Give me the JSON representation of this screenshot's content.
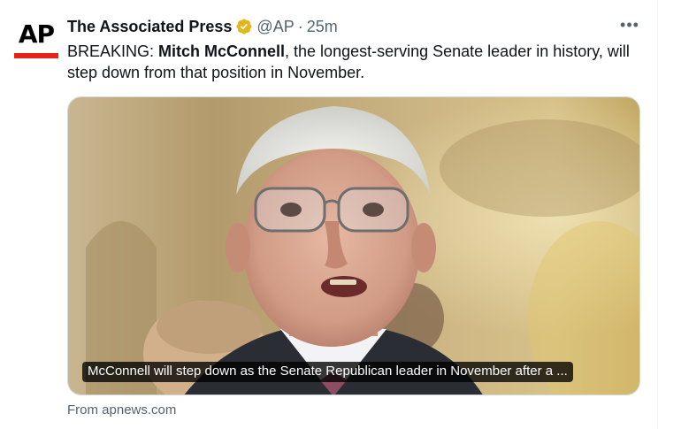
{
  "account": {
    "display_name": "The Associated Press",
    "handle": "@AP",
    "separator": "·",
    "timestamp": "25m",
    "avatar_text": "AP",
    "verified_icon": "verified-badge-icon",
    "verified_color": "#e2b719"
  },
  "more_icon": "•••",
  "tweet": {
    "prefix": "BREAKING: ",
    "bold_name": "Mitch McConnell",
    "rest": ", the longest-serving Senate leader in history, will step down from that position in November."
  },
  "card": {
    "caption": "McConnell will step down as the Senate Republican leader in November after a ...",
    "source": "From apnews.com"
  },
  "colors": {
    "text_primary": "#0f1419",
    "text_secondary": "#536471",
    "ap_red": "#e5231b"
  }
}
